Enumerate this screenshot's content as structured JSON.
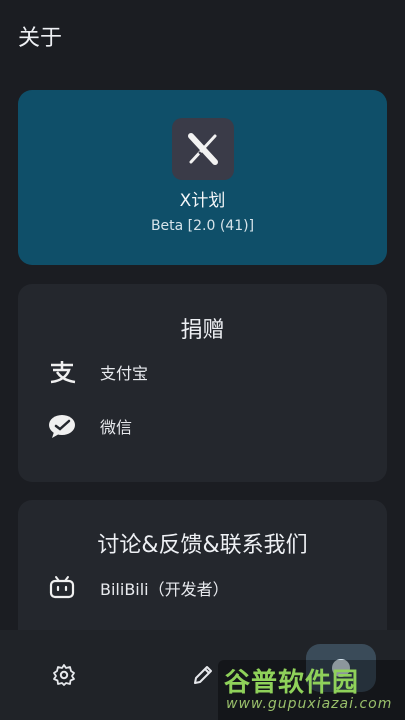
{
  "header": {
    "title": "关于"
  },
  "app": {
    "name": "X计划",
    "version": "Beta [2.0 (41)]",
    "logo_icon": "x-logo-icon"
  },
  "donate": {
    "title": "捐赠",
    "items": [
      {
        "label": "支付宝",
        "icon": "alipay-icon"
      },
      {
        "label": "微信",
        "icon": "wechat-icon"
      }
    ]
  },
  "contact": {
    "title": "讨论&反馈&联系我们",
    "items": [
      {
        "label": "BiliBili（开发者）",
        "icon": "bilibili-icon"
      }
    ]
  },
  "bottom_nav": {
    "items": [
      "settings-icon",
      "edit-icon"
    ]
  },
  "watermark": {
    "text": "谷普软件园",
    "url": "www.gupuxiazai.com"
  },
  "colors": {
    "background": "#1b1d22",
    "card": "#24272d",
    "accent_card": "#0f4f69",
    "watermark_green": "#8fd15a"
  }
}
